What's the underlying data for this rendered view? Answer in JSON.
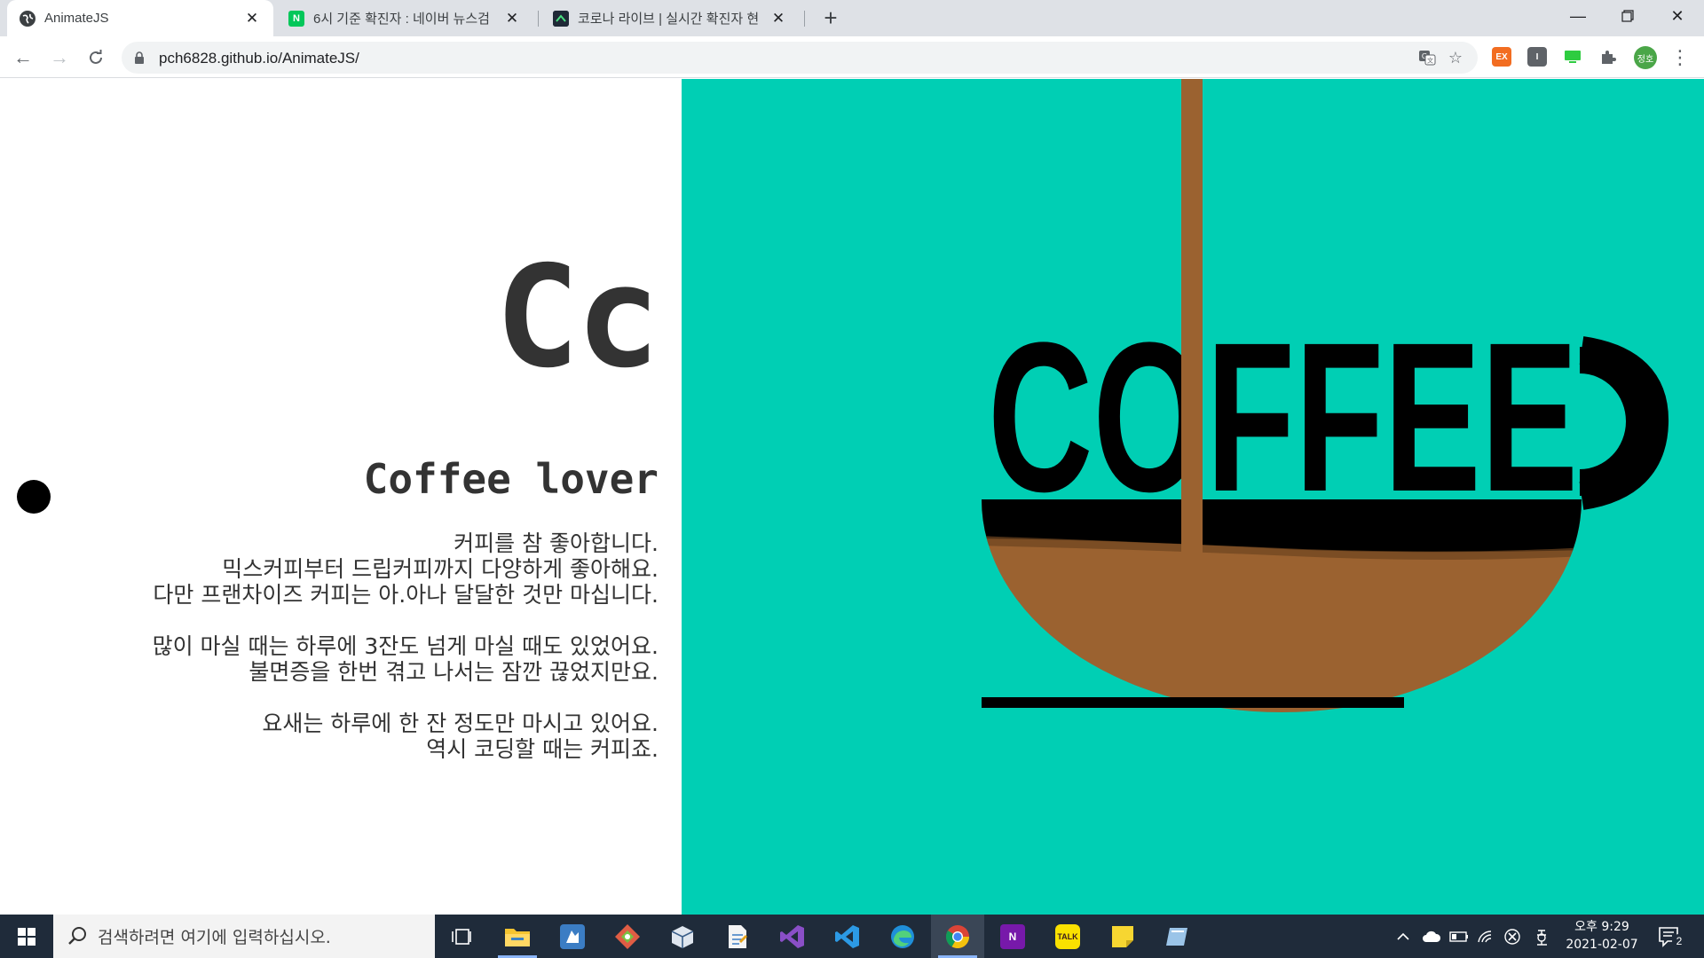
{
  "browser": {
    "tabs": [
      {
        "title": "AnimateJS",
        "active": true
      },
      {
        "title": "6시 기준 확진자 : 네이버 뉴스검",
        "active": false,
        "favicon_text": "N"
      },
      {
        "title": "코로나 라이브 | 실시간 확진자 현",
        "active": false
      }
    ],
    "address": "pch6828.github.io/AnimateJS/",
    "extensions": [
      "EX",
      "I",
      ""
    ],
    "profile_initials": "정호"
  },
  "page": {
    "big_letters": "Cc",
    "subtitle": "Coffee lover",
    "paragraphs": [
      [
        "커피를 참 좋아합니다.",
        "믹스커피부터 드립커피까지 다양하게 좋아해요.",
        "다만 프랜차이즈 커피는 아.아나 달달한 것만 마십니다."
      ],
      [
        "많이 마실 때는 하루에 3잔도 넘게 마실 때도 있었어요.",
        "불면증을 한번 겪고 나서는 잠깐 끊었지만요."
      ],
      [
        "요새는 하루에 한 잔 정도만 마시고 있어요.",
        "역시 코딩할 때는 커피죠."
      ]
    ],
    "art_word": "COFFEE",
    "colors": {
      "panel": "#00cfb4",
      "coffee": "#9b6230",
      "ink": "#000000",
      "text": "#333333"
    }
  },
  "taskbar": {
    "search_placeholder": "검색하려면 여기에 입력하십시오.",
    "clock_time": "오후 9:29",
    "clock_date": "2021-02-07",
    "notification_count": "2",
    "kakao_label": "TALK",
    "onenote_label": "N"
  }
}
